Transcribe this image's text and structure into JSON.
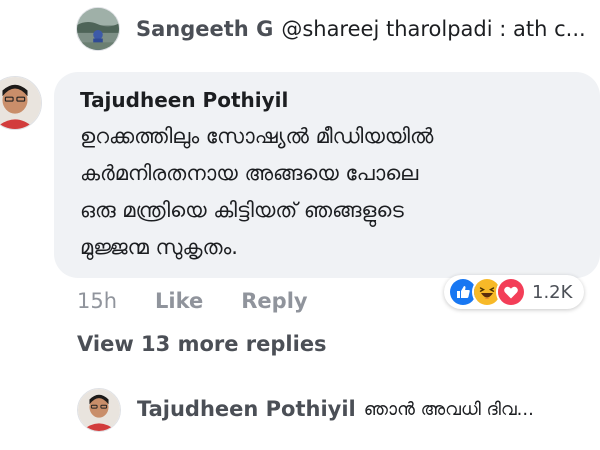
{
  "top_reply": {
    "author": "Sangeeth G",
    "snippet": "@shareej tharolpadi : ath c..."
  },
  "comment": {
    "author": "Tajudheen Pothiyil",
    "lines": [
      "ഉറക്കത്തിലും സോഷ്യൽ മീഡിയയിൽ",
      "കർമനിരതനായ അങ്ങയെ പോലെ",
      "ഒരു മന്ത്രിയെ കിട്ടിയത് ഞങ്ങളുടെ",
      "മുജ്ജന്മ സുകൃതം."
    ],
    "time": "15h",
    "like_label": "Like",
    "reply_label": "Reply",
    "reactions": {
      "icons": [
        "like-icon",
        "haha-icon",
        "love-icon"
      ],
      "count": "1.2K"
    }
  },
  "view_more_label": "View 13 more replies",
  "bottom_reply": {
    "author": "Tajudheen Pothiyil",
    "snippet": "ഞാൻ അവധി ദിവ..."
  },
  "colors": {
    "bubble_bg": "#f0f2f5",
    "like_blue": "#1877f2",
    "haha_yellow": "#f7b928",
    "love_red": "#f33e58",
    "meta_gray": "#90949c"
  }
}
